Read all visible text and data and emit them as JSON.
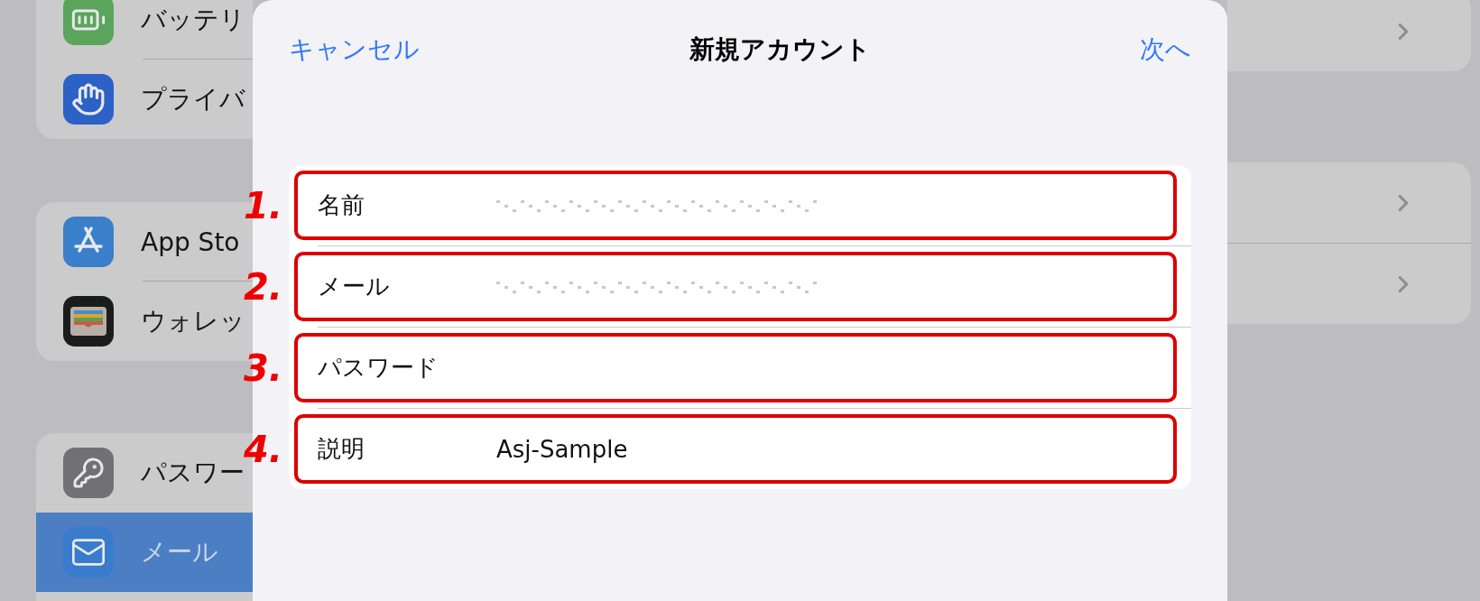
{
  "sidebar": {
    "groups": [
      {
        "items": [
          {
            "kind": "battery",
            "label": "バッテリ",
            "selected": false
          },
          {
            "kind": "hand",
            "label": "プライバ",
            "selected": false
          }
        ]
      },
      {
        "items": [
          {
            "kind": "appstore",
            "label": "App Sto",
            "selected": false
          },
          {
            "kind": "wallet",
            "label": "ウォレッ",
            "selected": false
          }
        ]
      },
      {
        "items": [
          {
            "kind": "key",
            "label": "パスワー",
            "selected": false
          },
          {
            "kind": "mail",
            "label": "メール",
            "selected": true
          }
        ]
      }
    ]
  },
  "modal": {
    "cancel": "キャンセル",
    "title": "新規アカウント",
    "next": "次へ",
    "fields": [
      {
        "number": "1.",
        "label": "名前",
        "redacted": true
      },
      {
        "number": "2.",
        "label": "メール",
        "redacted": true
      },
      {
        "number": "3.",
        "label": "パスワード",
        "redacted": false
      },
      {
        "number": "4.",
        "label": "説明",
        "value": "Asj-Sample",
        "redacted": false
      }
    ]
  },
  "detail": {
    "groups": [
      {
        "rows": [
          {
            "kind": "chevron"
          }
        ]
      },
      {
        "rows": [
          {
            "kind": "chevron"
          },
          {
            "kind": "chevron"
          }
        ]
      }
    ]
  }
}
